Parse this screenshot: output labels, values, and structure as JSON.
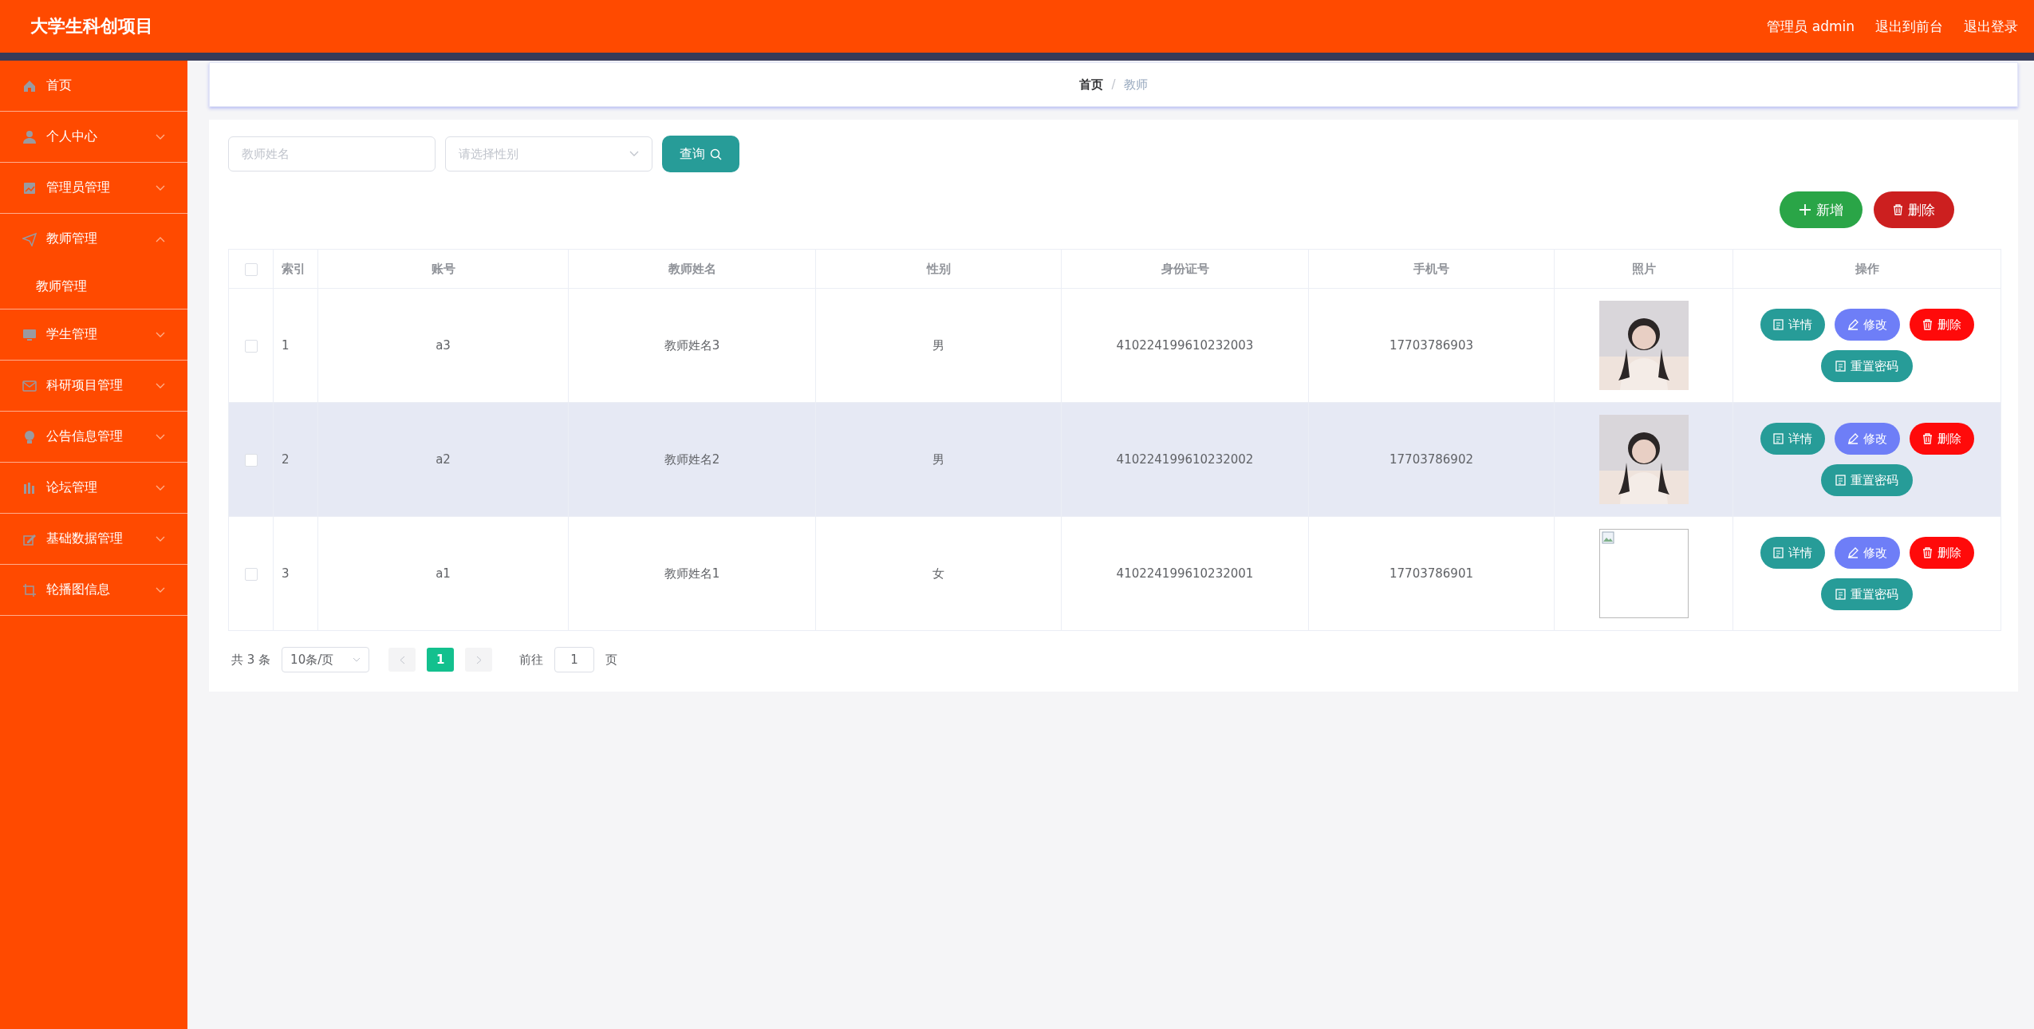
{
  "header": {
    "title": "大学生科创项目",
    "links": [
      "管理员 admin",
      "退出到前台",
      "退出登录"
    ]
  },
  "sidebar": {
    "items": [
      {
        "label": "首页",
        "kind": "link"
      },
      {
        "label": "个人中心",
        "kind": "submenu",
        "expanded": false
      },
      {
        "label": "管理员管理",
        "kind": "submenu",
        "expanded": false
      },
      {
        "label": "教师管理",
        "kind": "submenu",
        "expanded": true,
        "children": [
          {
            "label": "教师管理"
          }
        ]
      },
      {
        "label": "学生管理",
        "kind": "submenu",
        "expanded": false
      },
      {
        "label": "科研项目管理",
        "kind": "submenu",
        "expanded": false
      },
      {
        "label": "公告信息管理",
        "kind": "submenu",
        "expanded": false
      },
      {
        "label": "论坛管理",
        "kind": "submenu",
        "expanded": false
      },
      {
        "label": "基础数据管理",
        "kind": "submenu",
        "expanded": false
      },
      {
        "label": "轮播图信息",
        "kind": "submenu",
        "expanded": false
      }
    ]
  },
  "breadcrumb": {
    "items": [
      "首页",
      "教师"
    ],
    "separator": "/"
  },
  "search": {
    "fields": [
      {
        "kind": "input",
        "placeholder": "教师姓名"
      },
      {
        "kind": "select",
        "placeholder": "请选择性别"
      }
    ],
    "button": "查询"
  },
  "actions": [
    {
      "label": "新增",
      "kind": "add"
    },
    {
      "label": "删除",
      "kind": "delete"
    }
  ],
  "table": {
    "select_all": {
      "checked": false
    },
    "columns": [
      "索引",
      "账号",
      "教师姓名",
      "性别",
      "身份证号",
      "手机号",
      "照片",
      "操作"
    ],
    "rows": [
      {
        "checked": false,
        "highlighted": false,
        "cells": [
          "1",
          "a3",
          "教师姓名3",
          "男",
          "410224199610232003",
          "17703786903"
        ],
        "actions": [
          {
            "label": "详情",
            "kind": "detail"
          },
          {
            "label": "修改",
            "kind": "edit"
          },
          {
            "label": "删除",
            "kind": "delete"
          },
          {
            "label": "重置密码",
            "kind": "reset"
          }
        ]
      },
      {
        "checked": false,
        "highlighted": true,
        "cells": [
          "2",
          "a2",
          "教师姓名2",
          "男",
          "410224199610232002",
          "17703786902"
        ],
        "actions": [
          {
            "label": "详情",
            "kind": "detail"
          },
          {
            "label": "修改",
            "kind": "edit"
          },
          {
            "label": "删除",
            "kind": "delete"
          },
          {
            "label": "重置密码",
            "kind": "reset"
          }
        ]
      },
      {
        "checked": false,
        "highlighted": false,
        "cells": [
          "3",
          "a1",
          "教师姓名1",
          "女",
          "410224199610232001",
          "17703786901"
        ],
        "photo": {
          "kind": "broken"
        },
        "actions": [
          {
            "label": "详情",
            "kind": "detail"
          },
          {
            "label": "修改",
            "kind": "edit"
          },
          {
            "label": "删除",
            "kind": "delete"
          },
          {
            "label": "重置密码",
            "kind": "reset"
          }
        ]
      }
    ]
  },
  "pagination": {
    "total": "共 3 条",
    "page_size": "10条/页",
    "pages": [
      {
        "label": "1",
        "selected": true
      }
    ],
    "goto_label": "前往",
    "goto_value": "1",
    "page_unit": "页"
  }
}
